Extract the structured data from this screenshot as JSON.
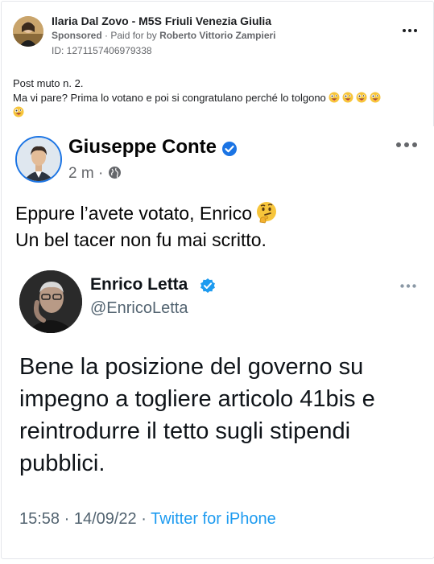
{
  "post": {
    "page_name": "Ilaria Dal Zovo - M5S Friuli Venezia Giulia",
    "sponsored_label": "Sponsored",
    "paid_prefix": "· Paid for by",
    "paid_by": "Roberto Vittorio Zampieri",
    "ad_id": "ID: 1271157406979338",
    "text_line1": "Post muto n. 2.",
    "text_line2": "Ma vi pare? Prima lo votano e poi si congratulano perché lo tolgono",
    "emoji_icon": "zany-face-emoji"
  },
  "facebook_post": {
    "author": "Giuseppe Conte",
    "time": "2 m ·",
    "text_line1": "Eppure l’avete votato, Enrico",
    "text_line2": "Un bel tacer non fu mai scritto.",
    "emoji_icon": "thinking-face-emoji"
  },
  "tweet": {
    "author": "Enrico Letta",
    "handle": "@EnricoLetta",
    "text_lines": [
      "Bene la posizione del governo su",
      "impegno a togliere articolo 41bis e",
      "reintrodurre il tetto sugli stipendi",
      "pubblici."
    ],
    "datetime": "15:58 · 14/09/22 ·",
    "source": "Twitter for iPhone"
  },
  "colors": {
    "verified_blue": "#1d9bf0",
    "facebook_blue": "#1b74e4",
    "secondary_text": "#65676b"
  }
}
